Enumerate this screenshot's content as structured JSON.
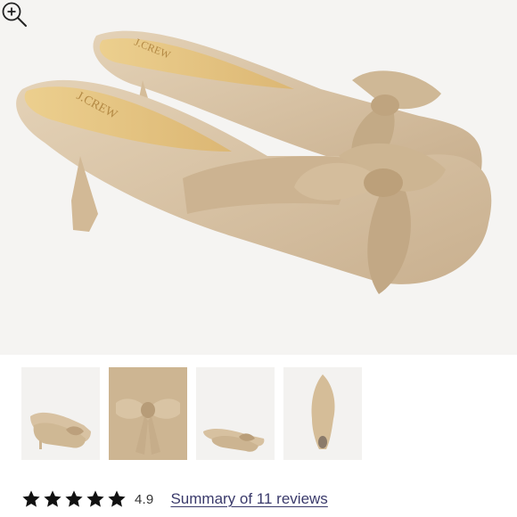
{
  "product": {
    "image_alt": "Beige bow kitten-heel mules",
    "brand_stamp": "J.CREW"
  },
  "gallery": {
    "thumbnails": [
      {
        "name": "pair-side-view",
        "selected": true
      },
      {
        "name": "bow-top-view",
        "selected": false
      },
      {
        "name": "pair-small-view",
        "selected": false
      },
      {
        "name": "sole-view",
        "selected": false
      }
    ]
  },
  "icons": {
    "zoom": "zoom-in-icon",
    "star": "star-icon"
  },
  "rating": {
    "stars_filled": 5,
    "stars_total": 5,
    "score": "4.9",
    "reviews_link": "Summary of 11 reviews"
  },
  "colors": {
    "shoe": "#d9c4a6",
    "insole": "#e9c98a",
    "link": "#3a3a6b",
    "star": "#111111"
  }
}
